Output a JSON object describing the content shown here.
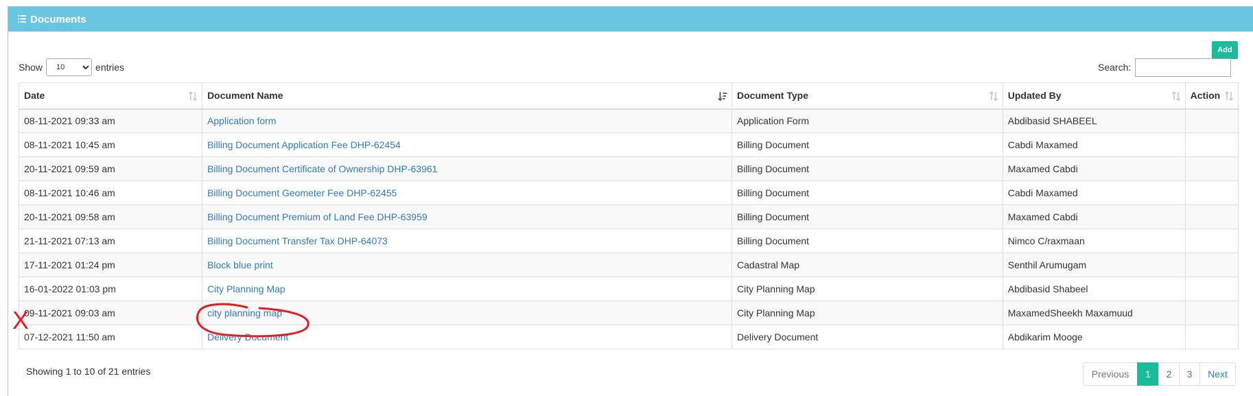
{
  "panel": {
    "title": "Documents"
  },
  "toolbar": {
    "add_label": "Add"
  },
  "length": {
    "show_label": "Show",
    "selected": "10",
    "entries_label": "entries"
  },
  "search": {
    "label": "Search:",
    "value": ""
  },
  "table": {
    "headers": {
      "date": "Date",
      "name": "Document Name",
      "type": "Document Type",
      "updated_by": "Updated By",
      "action": "Action"
    },
    "rows": [
      {
        "date": "08-11-2021 09:33 am",
        "name": "Application form",
        "type": "Application Form",
        "updated_by": "Abdibasid SHABEEL",
        "action": ""
      },
      {
        "date": "08-11-2021 10:45 am",
        "name": "Billing Document Application Fee DHP-62454",
        "type": "Billing Document",
        "updated_by": "Cabdi Maxamed",
        "action": ""
      },
      {
        "date": "20-11-2021 09:59 am",
        "name": "Billing Document Certificate of Ownership DHP-63961",
        "type": "Billing Document",
        "updated_by": "Maxamed Cabdi",
        "action": ""
      },
      {
        "date": "08-11-2021 10:46 am",
        "name": "Billing Document Geometer Fee DHP-62455",
        "type": "Billing Document",
        "updated_by": "Cabdi Maxamed",
        "action": ""
      },
      {
        "date": "20-11-2021 09:58 am",
        "name": "Billing Document Premium of Land Fee DHP-63959",
        "type": "Billing Document",
        "updated_by": "Maxamed Cabdi",
        "action": ""
      },
      {
        "date": "21-11-2021 07:13 am",
        "name": "Billing Document Transfer Tax DHP-64073",
        "type": "Billing Document",
        "updated_by": "Nimco C/raxmaan",
        "action": ""
      },
      {
        "date": "17-11-2021 01:24 pm",
        "name": "Block blue print",
        "type": "Cadastral Map",
        "updated_by": "Senthil Arumugam",
        "action": ""
      },
      {
        "date": "16-01-2022 01:03 pm",
        "name": "City Planning Map",
        "type": "City Planning Map",
        "updated_by": "Abdibasid Shabeel",
        "action": ""
      },
      {
        "date": "09-11-2021 09:03 am",
        "name": "city planning map",
        "type": "City Planning Map",
        "updated_by": "MaxamedSheekh Maxamuud",
        "action": ""
      },
      {
        "date": "07-12-2021 11:50 am",
        "name": "Delivery Document",
        "type": "Delivery Document",
        "updated_by": "Abdikarim Mooge",
        "action": ""
      }
    ]
  },
  "info": "Showing 1 to 10 of 21 entries",
  "pagination": {
    "previous": "Previous",
    "pages": [
      "1",
      "2",
      "3"
    ],
    "next": "Next",
    "current": "1"
  },
  "annotation": {
    "mark": "X"
  },
  "colors": {
    "header": "#6ac6e0",
    "accent": "#1abc9c",
    "link": "#337ab7",
    "annotation": "#e31b23"
  },
  "icons": {
    "header": "list-icon",
    "sort": "sort-icon",
    "sort_active": "sort-alpha-asc-icon"
  }
}
